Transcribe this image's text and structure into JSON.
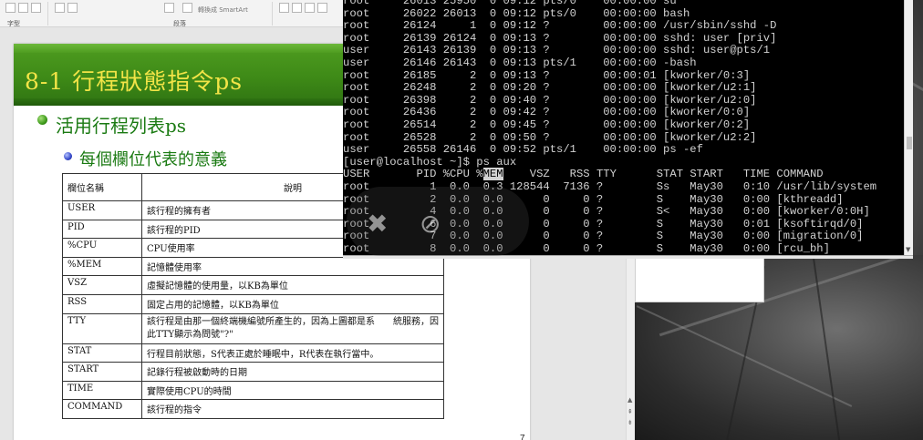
{
  "ribbon": {
    "group_font": "字型",
    "group_paragraph": "段落",
    "smartart": "轉換成 SmartArt"
  },
  "slide": {
    "title": "8-1 行程狀態指令ps",
    "bullet1": "活用行程列表ps",
    "bullet2": "每個欄位代表的意義",
    "table_header": [
      "欄位名稱",
      "說明"
    ],
    "rows": [
      {
        "name": "USER",
        "desc": "該行程的擁有者"
      },
      {
        "name": "PID",
        "desc": "該行程的PID"
      },
      {
        "name": "%CPU",
        "desc": "CPU使用率"
      },
      {
        "name": "%MEM",
        "desc": "記憶體使用率"
      },
      {
        "name": "VSZ",
        "desc": "虛擬記憶體的使用量，以KB為單位"
      },
      {
        "name": "RSS",
        "desc": "固定占用的記憶體，以KB為單位"
      },
      {
        "name": "TTY",
        "desc": "該行程是由那一個終端機編號所產生的，因為上圖都是系　　統服務，因此TTY顯示為問號\"?\""
      },
      {
        "name": "STAT",
        "desc": "行程目前狀態，S代表正處於睡眠中，R代表在執行當中。"
      },
      {
        "name": "START",
        "desc": "記錄行程被啟動時的日期"
      },
      {
        "name": "TIME",
        "desc": "實際使用CPU的時間"
      },
      {
        "name": "COMMAND",
        "desc": "該行程的指令"
      }
    ],
    "page_number": "7"
  },
  "terminal": {
    "lines": [
      "root     26013 25950  0 09:12 pts/0    00:00:00 su",
      "root     26022 26013  0 09:12 pts/0    00:00:00 bash",
      "root     26124     1  0 09:12 ?        00:00:00 /usr/sbin/sshd -D",
      "root     26139 26124  0 09:13 ?        00:00:00 sshd: user [priv]",
      "user     26143 26139  0 09:13 ?        00:00:00 sshd: user@pts/1",
      "user     26146 26143  0 09:13 pts/1    00:00:00 -bash",
      "root     26185     2  0 09:13 ?        00:00:01 [kworker/0:3]",
      "root     26248     2  0 09:20 ?        00:00:00 [kworker/u2:1]",
      "root     26398     2  0 09:40 ?        00:00:00 [kworker/u2:0]",
      "root     26436     2  0 09:42 ?        00:00:00 [kworker/0:0]",
      "root     26514     2  0 09:45 ?        00:00:00 [kworker/0:2]",
      "root     26528     2  0 09:50 ?        00:00:00 [kworker/u2:2]",
      "user     26558 26146  0 09:52 pts/1    00:00:00 ps -ef",
      "[user@localhost ~]$ ps aux",
      "USER       PID %CPU %MEM    VSZ   RSS TTY      STAT START   TIME COMMAND",
      "root         1  0.0  0.3 128544  7136 ?        Ss   May30   0:10 /usr/lib/system",
      "root         2  0.0  0.0      0     0 ?        S    May30   0:00 [kthreadd]",
      "root         4  0.0  0.0      0     0 ?        S<   May30   0:00 [kworker/0:0H]",
      "root         6  0.0  0.0      0     0 ?        S    May30   0:01 [ksoftirqd/0]",
      "root         7  0.0  0.0      0     0 ?        S    May30   0:00 [migration/0]",
      "root         8  0.0  0.0      0     0 ?        S    May30   0:00 [rcu_bh]"
    ],
    "highlight_word": "MEM"
  },
  "overlay": {
    "mic_icon": "mic-off-icon",
    "cam_icon": "camera-off-icon"
  }
}
